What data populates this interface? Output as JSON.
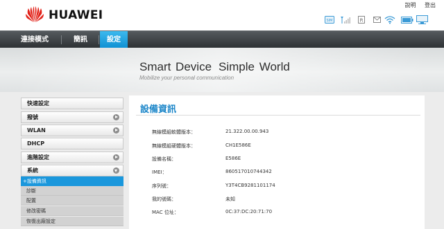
{
  "header": {
    "brand": "HUAWEI",
    "links": {
      "help": "說明",
      "logout": "登出"
    },
    "status_icons": [
      "sim-icon",
      "signal-icon",
      "roaming-icon",
      "sms-icon",
      "wifi-icon",
      "battery-icon",
      "internet-icon"
    ],
    "brand_color": "#e2231a"
  },
  "nav": {
    "items": [
      {
        "label": "連接模式"
      },
      {
        "label": "簡訊"
      },
      {
        "label": "設定"
      }
    ],
    "active_index": 2,
    "active_color": "#1a97dc"
  },
  "banner": {
    "slogan_part1": "Smart Device",
    "slogan_part2": "Simple World",
    "subslogan": "Mobilize your personal communication"
  },
  "sidebar": {
    "items": [
      {
        "label": "快速設定"
      },
      {
        "label": "撥號"
      },
      {
        "label": "WLAN"
      },
      {
        "label": "DHCP"
      },
      {
        "label": "進階設定"
      },
      {
        "label": "系統"
      }
    ],
    "system_subitems": [
      {
        "label": "+設備資訊"
      },
      {
        "label": "診斷"
      },
      {
        "label": "配置"
      },
      {
        "label": "修改密碼"
      },
      {
        "label": "恢復出廠設定"
      }
    ]
  },
  "main": {
    "title": "設備資訊",
    "rows": [
      {
        "label": "無線模組軟體版本：",
        "value": "21.322.00.00.943"
      },
      {
        "label": "無線模組硬體版本：",
        "value": "CH1E586E"
      },
      {
        "label": "設備名稱：",
        "value": "E586E"
      },
      {
        "label": "IMEI：",
        "value": "860517010744342"
      },
      {
        "label": "序列號：",
        "value": "Y3T4CB9281101174"
      },
      {
        "label": "我的號碼：",
        "value": "未知"
      },
      {
        "label": "MAC 位址：",
        "value": "0C:37:DC:20:71:70"
      }
    ]
  }
}
